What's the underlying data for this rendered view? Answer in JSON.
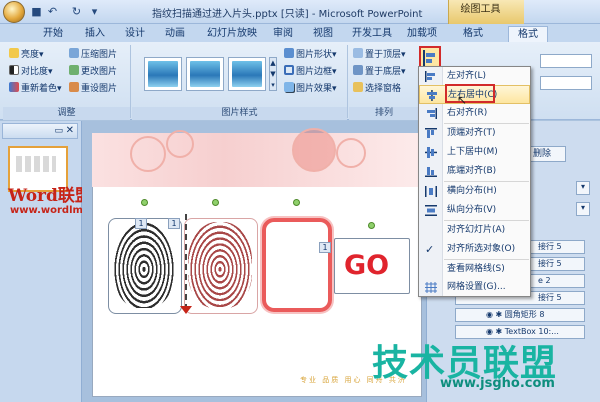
{
  "window": {
    "title": "指纹扫描通过进入片头.pptx [只读] - Microsoft PowerPoint",
    "context_tab_group": "绘图工具"
  },
  "ribbon_tabs": [
    {
      "label": "开始"
    },
    {
      "label": "插入"
    },
    {
      "label": "设计"
    },
    {
      "label": "动画"
    },
    {
      "label": "幻灯片放映"
    },
    {
      "label": "审阅"
    },
    {
      "label": "视图"
    },
    {
      "label": "开发工具"
    },
    {
      "label": "加载项"
    },
    {
      "label": "格式"
    },
    {
      "label": "格式",
      "active": true
    }
  ],
  "ribbon": {
    "adjust": {
      "label": "调整",
      "brightness": "亮度",
      "contrast": "对比度",
      "recolor": "重新着色",
      "compress": "压缩图片",
      "change_picture": "更改图片",
      "reset_picture": "重设图片"
    },
    "picture_styles": {
      "label": "图片样式",
      "shape": "图片形状",
      "border": "图片边框",
      "effects": "图片效果"
    },
    "arrange": {
      "label": "排列",
      "bring_front": "置于顶层",
      "send_back": "置于底层",
      "selection_pane": "选择窗格"
    }
  },
  "align_menu": {
    "items": [
      {
        "label": "左对齐(L)",
        "icon": "align-left-icon"
      },
      {
        "label": "左右居中(C)",
        "icon": "align-center-icon",
        "highlighted": true
      },
      {
        "label": "右对齐(R)",
        "icon": "align-right-icon"
      },
      {
        "label": "顶端对齐(T)",
        "icon": "align-top-icon"
      },
      {
        "label": "上下居中(M)",
        "icon": "align-middle-icon"
      },
      {
        "label": "底端对齐(B)",
        "icon": "align-bottom-icon"
      },
      {
        "label": "横向分布(H)",
        "icon": "distribute-horizontal-icon"
      },
      {
        "label": "纵向分布(V)",
        "icon": "distribute-vertical-icon"
      },
      {
        "label": "对齐幻灯片(A)",
        "icon": "align-slide-icon"
      },
      {
        "label": "对齐所选对象(O)",
        "icon": "check-icon",
        "checked": true
      },
      {
        "label": "查看网格线(S)",
        "icon": "grid-icon"
      },
      {
        "label": "网格设置(G)...",
        "icon": "grid-settings-icon"
      }
    ]
  },
  "selection_pane": {
    "delete_button": "删除",
    "rows": [
      "接行 5",
      "接行 5",
      "e 2",
      "接行 5",
      "圆角矩形 8",
      "TextBox 10:..."
    ]
  },
  "slide": {
    "go_text": "GO",
    "footer_text": "专业  品质  用心  同舟  共济"
  },
  "watermarks": {
    "left_logo": "Word联盟",
    "left_url": "www.wordlm.com",
    "right_logo": "技术员联盟",
    "right_url": "www.jsgho.com"
  },
  "colors": {
    "highlight_red": "#d22a2a",
    "go_red": "#e0242d",
    "watermark_green": "#19b4a2"
  }
}
